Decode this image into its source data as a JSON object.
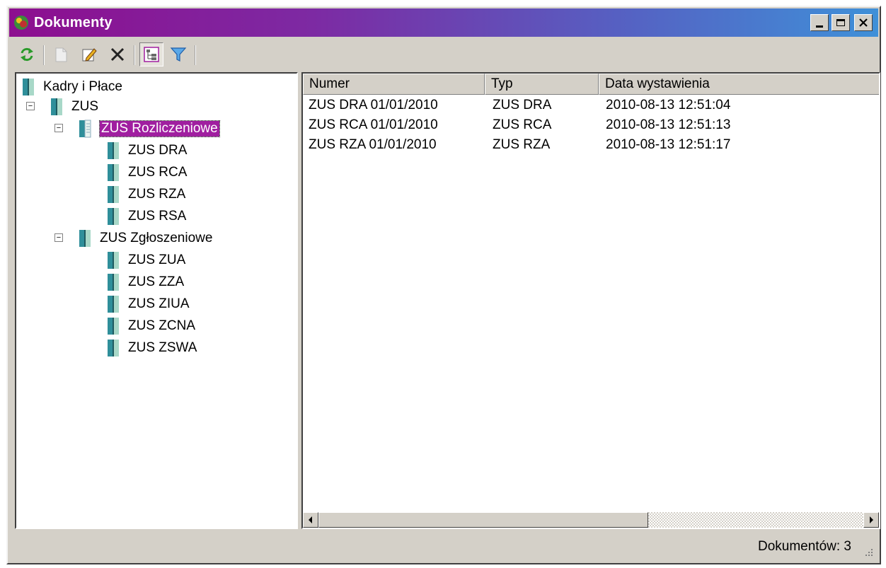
{
  "window": {
    "title": "Dokumenty"
  },
  "toolbar": {
    "items": [
      {
        "name": "refresh-icon",
        "enabled": true
      },
      {
        "name": "new-document-icon",
        "enabled": false
      },
      {
        "name": "edit-icon",
        "enabled": true
      },
      {
        "name": "delete-icon",
        "enabled": true
      },
      {
        "name": "tree-view-icon",
        "enabled": true,
        "pressed": true
      },
      {
        "name": "filter-icon",
        "enabled": true
      }
    ]
  },
  "tree": {
    "root": "Kadry i Płace",
    "zus": "ZUS",
    "rozliczeniowe": "ZUS Rozliczeniowe",
    "rozliczeniowe_items": [
      "ZUS DRA",
      "ZUS RCA",
      "ZUS RZA",
      "ZUS RSA"
    ],
    "zgloszeniowe": "ZUS Zgłoszeniowe",
    "zgloszeniowe_items": [
      "ZUS ZUA",
      "ZUS ZZA",
      "ZUS ZIUA",
      "ZUS ZCNA",
      "ZUS ZSWA"
    ],
    "expander_collapse_glyph": "−"
  },
  "list": {
    "columns": [
      "Numer",
      "Typ",
      "Data wystawienia"
    ],
    "rows": [
      [
        "ZUS DRA 01/01/2010",
        "ZUS DRA",
        "2010-08-13 12:51:04"
      ],
      [
        "ZUS RCA 01/01/2010",
        "ZUS RCA",
        "2010-08-13 12:51:13"
      ],
      [
        "ZUS RZA 01/01/2010",
        "ZUS RZA",
        "2010-08-13 12:51:17"
      ]
    ]
  },
  "status": {
    "text": "Dokumentów: 3"
  },
  "colors": {
    "selection": "#a01fa0",
    "title_start": "#8d0e8f",
    "title_end": "#3f90d8",
    "face": "#d4d0c8"
  }
}
